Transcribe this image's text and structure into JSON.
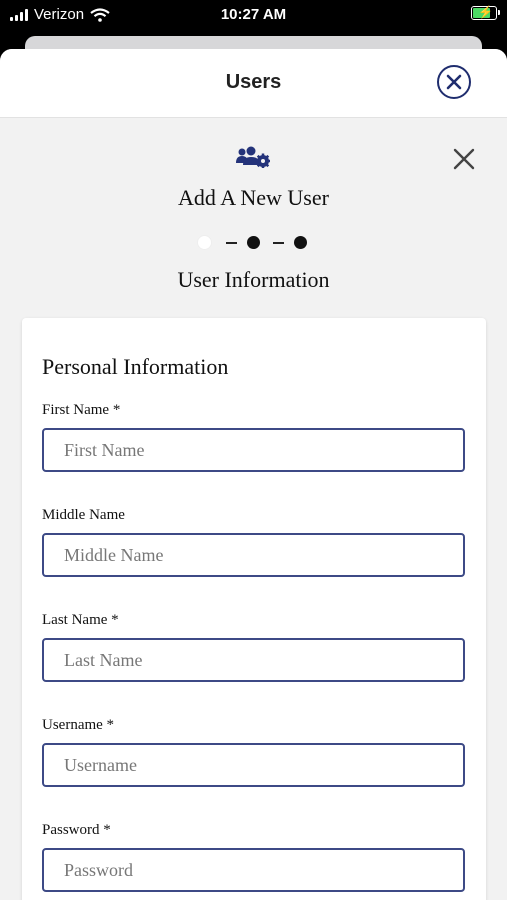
{
  "status_bar": {
    "carrier": "Verizon",
    "time": "10:27 AM"
  },
  "header": {
    "title": "Users"
  },
  "wizard": {
    "heading": "Add A New User",
    "step_label": "User Information",
    "steps": [
      {
        "state": "completed"
      },
      {
        "state": "current"
      },
      {
        "state": "upcoming"
      }
    ]
  },
  "form": {
    "section_title": "Personal Information",
    "fields": [
      {
        "label": "First Name *",
        "placeholder": "First Name"
      },
      {
        "label": "Middle Name",
        "placeholder": "Middle Name"
      },
      {
        "label": "Last Name *",
        "placeholder": "Last Name"
      },
      {
        "label": "Username *",
        "placeholder": "Username"
      },
      {
        "label": "Password *",
        "placeholder": "Password"
      }
    ]
  },
  "icons": {
    "header_close": "close-circle-icon",
    "content_close": "close-icon",
    "wizard": "users-gear-icon"
  },
  "colors": {
    "accent": "#1f2d6e",
    "input_border": "#3d4a86",
    "background": "#f2f2f2"
  }
}
